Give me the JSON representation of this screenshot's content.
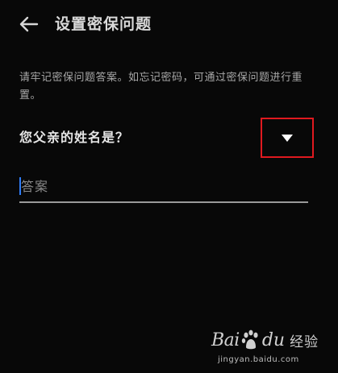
{
  "header": {
    "back_icon": "arrow-left-icon",
    "title": "设置密保问题"
  },
  "hint": "请牢记密保问题答案。如忘记密码，可通过密保问题进行重置。",
  "question": {
    "selected": "您父亲的姓名是？",
    "dropdown_icon": "triangle-down-icon"
  },
  "answer": {
    "placeholder": "答案",
    "value": ""
  },
  "colors": {
    "background": "#080808",
    "highlight_box": "#e0191f",
    "caret": "#2f7df6"
  },
  "watermark": {
    "bai": "Bai",
    "du": "du",
    "jingyan": "经验",
    "url": "jingyan.baidu.com"
  }
}
